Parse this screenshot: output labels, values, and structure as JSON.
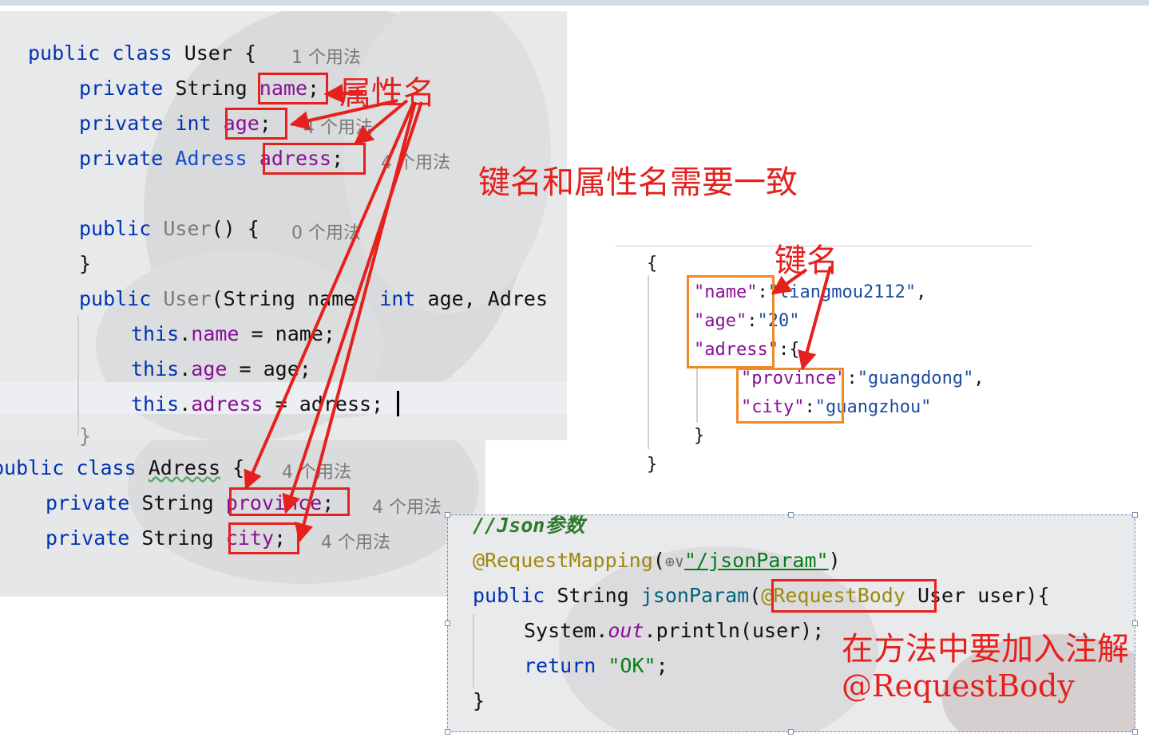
{
  "user_class": {
    "header": {
      "kw1": "public",
      "kw2": "class",
      "name": "User",
      "brace": "{",
      "hint": "1 个用法"
    },
    "field_name": {
      "kw": "private",
      "type": "String",
      "field": "name",
      "semi": ";"
    },
    "field_age": {
      "kw": "private",
      "type": "int",
      "field": "age",
      "semi": ";",
      "hint": "4 个用法"
    },
    "field_adress": {
      "kw": "private",
      "type": "Adress",
      "field": "adress",
      "semi": ";",
      "hint": "4 个用法"
    },
    "ctor1": {
      "kw": "public",
      "name": "User",
      "rest": "() {",
      "hint": "0 个用法"
    },
    "ctor1_close": "}",
    "ctor2": {
      "kw": "public",
      "name": "User",
      "p1": "(String name, ",
      "kw_int": "int",
      "p2": " age, Adres"
    },
    "assign_name": {
      "this": "this",
      "dot": ".",
      "field": "name",
      "rest": " = name;"
    },
    "assign_age": {
      "this": "this",
      "dot": ".",
      "field": "age",
      "rest": " = age;"
    },
    "assign_adress": {
      "this": "this",
      "dot": ".",
      "field": "adress",
      "rest": " = adress;"
    },
    "partial_brace": "}"
  },
  "adress_class": {
    "header": {
      "kw1": "public",
      "kw2": "class",
      "name": "Adress",
      "brace": "{",
      "hint": "4 个用法"
    },
    "field_province": {
      "kw": "private",
      "type": "String",
      "field": "province",
      "semi": ";",
      "hint": "4 个用法"
    },
    "field_city": {
      "kw": "private",
      "type": "String",
      "field": "city",
      "semi": ";",
      "hint": "4 个用法"
    }
  },
  "json_sample": {
    "open": "{",
    "name_key": "\"name\"",
    "name_val": "\"liangmou2112\"",
    "age_key": "\"age\"",
    "age_val": "\"20\"",
    "adress_key": "\"adress\"",
    "adress_rest": ":{",
    "province_key": "\"province\"",
    "province_val": "\"guangdong\"",
    "city_key": "\"city\"",
    "city_val": "\"guangzhou\"",
    "colon": ":",
    "comma": ",",
    "inner_close": "}",
    "close": "}"
  },
  "controller": {
    "comment": "//Json参数",
    "mapping_anno": "@RequestMapping",
    "mapping_paren": "(",
    "mapping_globe": "⊕∨",
    "mapping_path": "\"/jsonParam\"",
    "mapping_close": ")",
    "sig_kw": "public",
    "sig_type": "String",
    "sig_method": "jsonParam",
    "sig_paren": "(",
    "sig_anno": "@RequestBody",
    "sig_rest": " User user){",
    "print_obj": "System.",
    "print_out": "out",
    "print_rest": ".println(user);",
    "return_kw": "return",
    "return_val": "\"OK\"",
    "return_semi": ";",
    "close": "}"
  },
  "annotations": {
    "attr_name": "属性名",
    "rule": "键名和属性名需要一致",
    "key_name": "键名",
    "method_note": "在方法中要加入注解",
    "method_anno": "@RequestBody"
  },
  "colors": {
    "annotation_red": "#e5201d",
    "annotation_orange": "#f08a24"
  }
}
